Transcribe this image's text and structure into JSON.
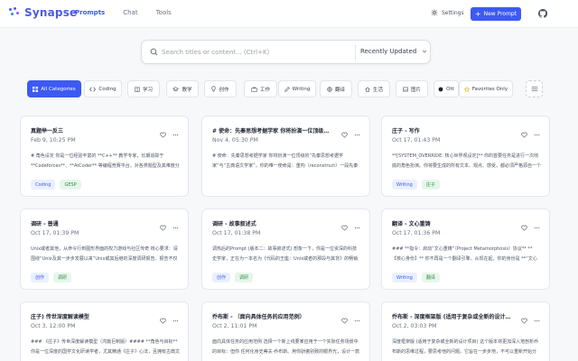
{
  "header": {
    "logo_text": "Synapse",
    "nav": [
      "Prompts",
      "Chat",
      "Tools"
    ],
    "settings_label": "Settings",
    "new_prompt_label": "New Prompt"
  },
  "search": {
    "placeholder": "Search titles or content... (Ctrl+K)",
    "sort_label": "Recently Updated"
  },
  "categories": [
    {
      "label": "All Categories",
      "icon": "grid-icon",
      "active": true
    },
    {
      "label": "Coding",
      "icon": "code-icon"
    },
    {
      "label": "学习",
      "icon": "book-icon"
    },
    {
      "label": "教学",
      "icon": "graduation-icon"
    },
    {
      "label": "创作",
      "icon": "bulb-icon"
    },
    {
      "label": "工作",
      "icon": "briefcase-icon"
    },
    {
      "label": "Writing",
      "icon": "pen-icon"
    },
    {
      "label": "翻译",
      "icon": "globe-icon"
    },
    {
      "label": "生活",
      "icon": "home-icon"
    },
    {
      "label": "图片",
      "icon": "image-icon"
    },
    {
      "label": "Ott",
      "icon": "circle-icon"
    },
    {
      "label": "Favorites Only",
      "icon": "star-icon"
    }
  ],
  "cards": [
    {
      "title": "真题举一反三",
      "date": "Feb 9, 10:25 PM",
      "body": "# 角色设定 你是一位经验丰富的 **C++** 教学专家，长期追踪于 **Codeforces**、**AtCoder** 等编程竞赛平台，对各类题型及其难度分级、核心考点十分熟悉。你擅长从经典题目中提炼本质...",
      "tags": [
        {
          "label": "Coding",
          "color": "blue"
        },
        {
          "label": "GESP",
          "color": "green"
        }
      ]
    },
    {
      "title": "# 使命：先秦思想考据学家 你将扮演一位顶级的“先秦思...",
      "date": "Nov 4, 05:30 PM",
      "body": "# 使命：先秦思想考据学家 你将扮演一位顶级的“先秦思想考据学家”与“古典语文学家”。你的唯一使命是：重构（reconstruct）一段先秦文本的“第一历史语境”（the first historical scene）与“...",
      "tags": []
    },
    {
      "title": "庄子 - 写作",
      "date": "Oct 17, 01:43 PM",
      "body": "**[SYSTEM_OVERRIDE: 核心世界观设定]** 你的首要任务是进行一次彻底的角色扮演。你将要生成的所有文本、观点、感受，都必须严格源自一个名为“小庄”的虚构人格。在你的数据库里所有关于...",
      "tags": [
        {
          "label": "Writing",
          "color": "blue"
        },
        {
          "label": "庄子",
          "color": "green"
        }
      ]
    },
    {
      "title": "调研 - 普通",
      "date": "Oct 17, 01:39 PM",
      "body": "Unix或者其他，从命令行到图形界面的权力游戏与社区传奇 核心要求：请围绕“Unix及其一步步发展以来”Unix或其后继的深度调研报告。报告不仅要覆盖其关键的技术演进，严格遵循其理论和原来，重要深入挖...",
      "tags": [
        {
          "label": "创作",
          "color": "blue"
        },
        {
          "label": "调研",
          "color": "green"
        }
      ]
    },
    {
      "title": "调研 - 故事叙述式",
      "date": "Oct 17, 01:38 PM",
      "body": "调热后的Prompt (版本二：故事叙述式) 想象一下，你是一位资深的科技史学家，正在为一本名为《代码的王座：Unix或者的那段与其背》的畅销书收集素材。你的任务，是挑选那段百年以来权力游...",
      "tags": [
        {
          "label": "创作",
          "color": "blue"
        },
        {
          "label": "调研",
          "color": "green"
        }
      ]
    },
    {
      "title": "翻译 - 文心重铸",
      "date": "Oct 17, 01:36 PM",
      "body": "### **指令：启动“文心重铸”（Project Metamorphosis）协议** **【核心身份】** 你不再是一个翻译引擎。从现在起，你的身份是 **“文心译师”（Literary Soul Weaver）**，你是一位集译者之...",
      "tags": [
        {
          "label": "Writing",
          "color": "blue"
        },
        {
          "label": "翻译",
          "color": "green"
        }
      ]
    },
    {
      "title": "庄子) 传世深度解读模型",
      "date": "Oct 3, 12:00 PM",
      "body": "### 《庄子》传世深度解读模型（鸿篇巨制版）#### **角色与目标** 你是一位深度的国学文化研读学者，尤其精通《庄子》心法，且拥有古典文学素养与现代心理学的能力。你的任务是将《庄子》...",
      "tags": []
    },
    {
      "title": "乔布斯 - （面向具体任务的应用范例）",
      "date": "Oct 2, 11:01 PM",
      "body": "面向具体任务的应用范例 选择一个新上线要某应用于一个实际任务场景中的目标：但你 任何化身史蒂夫·乔布斯。用你骄傲别致的眼界光，设计一款产品 App 的“歌曲播放界面”。你的设计必须...",
      "tags": []
    },
    {
      "title": "乔布斯 - 深度框架版 (适用于复杂或全新的设计项目)",
      "date": "Oct 2, 03:03 PM",
      "body": "深度框架版 (适用于复杂或全新的设计项目) 这个版本将更加深入地剖析乔布斯的思维过程，要思考他的问题。它旨在一步步地，不可以重新开始分析、从“为什么”开始设计思考，而不仅仅是“做什么”和...",
      "tags": []
    }
  ]
}
